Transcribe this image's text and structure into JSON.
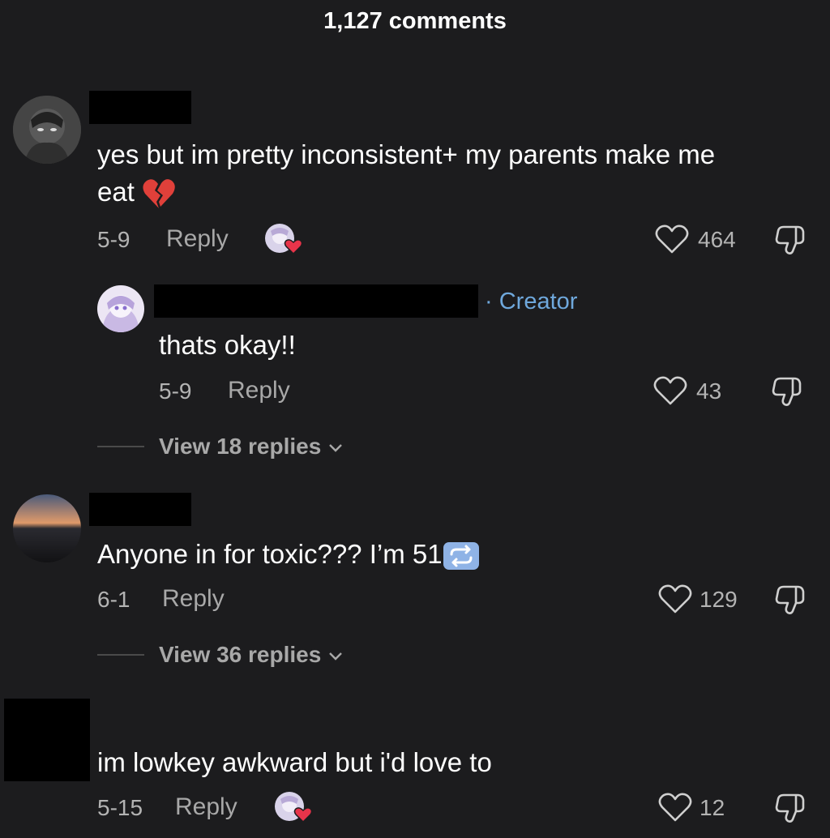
{
  "header": {
    "comment_count": "1,127 comments"
  },
  "comments": [
    {
      "text_line1": "yes but im pretty inconsistent+ my parents make me",
      "text_line2": "eat",
      "text_emoji": "broken-heart-icon",
      "date": "5-9",
      "reply_label": "Reply",
      "creator_liked": true,
      "likes": "464",
      "replies": [
        {
          "badge": "· Creator",
          "text": "thats okay!!",
          "date": "5-9",
          "reply_label": "Reply",
          "likes": "43"
        }
      ],
      "view_replies_label": "View 18 replies"
    },
    {
      "text": "Anyone in for toxic??? I’m 51",
      "text_emoji": "repeat-icon",
      "date": "6-1",
      "reply_label": "Reply",
      "likes": "129",
      "view_replies_label": "View 36 replies"
    },
    {
      "text": "im lowkey awkward but i'd love to",
      "date": "5-15",
      "reply_label": "Reply",
      "creator_liked": true,
      "likes": "12"
    }
  ],
  "colors": {
    "background": "#1c1c1e",
    "creator_badge": "#6fa8dc",
    "muted_text": "#b3b3b3"
  }
}
